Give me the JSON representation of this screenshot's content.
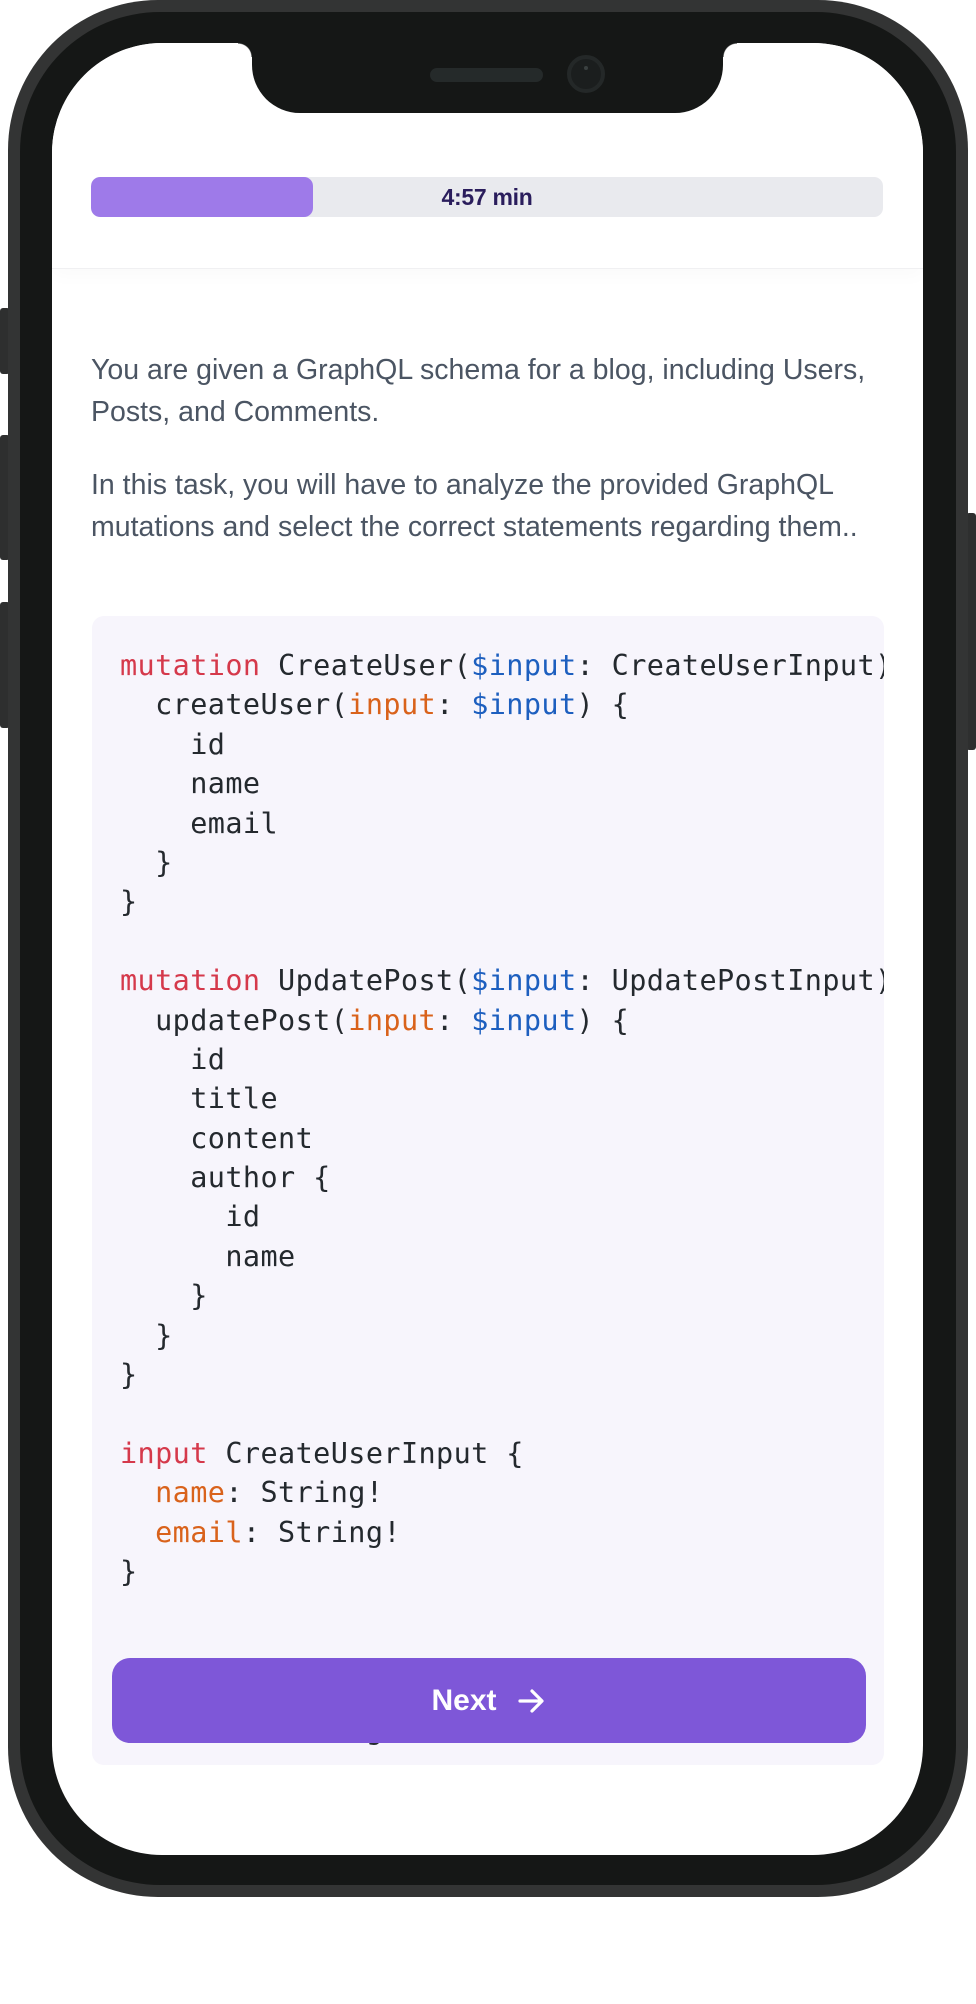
{
  "header": {
    "timer_label": "4:57 min",
    "progress_fraction": 0.28,
    "progress_fill_color": "#9e7ae9",
    "progress_track_color": "#e9eaee"
  },
  "intro": {
    "paragraphs": [
      "You are given a GraphQL schema for a blog, including Users, Posts, and Comments.",
      "In this task, you will have to analyze the provided GraphQL mutations and select the correct statements regarding them.."
    ]
  },
  "code": {
    "language": "graphql",
    "lines": [
      [
        {
          "t": "mutation",
          "k": "keyword"
        },
        {
          "t": " CreateUser(",
          "k": "plain"
        },
        {
          "t": "$input",
          "k": "variable"
        },
        {
          "t": ": CreateUserInput) {",
          "k": "plain"
        }
      ],
      [
        {
          "t": "  createUser(",
          "k": "plain"
        },
        {
          "t": "input",
          "k": "arg"
        },
        {
          "t": ": ",
          "k": "plain"
        },
        {
          "t": "$input",
          "k": "variable"
        },
        {
          "t": ") {",
          "k": "plain"
        }
      ],
      [
        {
          "t": "    id",
          "k": "plain"
        }
      ],
      [
        {
          "t": "    name",
          "k": "plain"
        }
      ],
      [
        {
          "t": "    email",
          "k": "plain"
        }
      ],
      [
        {
          "t": "  }",
          "k": "plain"
        }
      ],
      [
        {
          "t": "}",
          "k": "plain"
        }
      ],
      [],
      [
        {
          "t": "mutation",
          "k": "keyword"
        },
        {
          "t": " UpdatePost(",
          "k": "plain"
        },
        {
          "t": "$input",
          "k": "variable"
        },
        {
          "t": ": UpdatePostInput) {",
          "k": "plain"
        }
      ],
      [
        {
          "t": "  updatePost(",
          "k": "plain"
        },
        {
          "t": "input",
          "k": "arg"
        },
        {
          "t": ": ",
          "k": "plain"
        },
        {
          "t": "$input",
          "k": "variable"
        },
        {
          "t": ") {",
          "k": "plain"
        }
      ],
      [
        {
          "t": "    id",
          "k": "plain"
        }
      ],
      [
        {
          "t": "    title",
          "k": "plain"
        }
      ],
      [
        {
          "t": "    content",
          "k": "plain"
        }
      ],
      [
        {
          "t": "    author {",
          "k": "plain"
        }
      ],
      [
        {
          "t": "      id",
          "k": "plain"
        }
      ],
      [
        {
          "t": "      name",
          "k": "plain"
        }
      ],
      [
        {
          "t": "    }",
          "k": "plain"
        }
      ],
      [
        {
          "t": "  }",
          "k": "plain"
        }
      ],
      [
        {
          "t": "}",
          "k": "plain"
        }
      ],
      [],
      [
        {
          "t": "input",
          "k": "keyword"
        },
        {
          "t": " CreateUserInput {",
          "k": "plain"
        }
      ],
      [
        {
          "t": "  ",
          "k": "plain"
        },
        {
          "t": "name",
          "k": "arg"
        },
        {
          "t": ": String!",
          "k": "plain"
        }
      ],
      [
        {
          "t": "  ",
          "k": "plain"
        },
        {
          "t": "email",
          "k": "arg"
        },
        {
          "t": ": String!",
          "k": "plain"
        }
      ],
      [
        {
          "t": "}",
          "k": "plain"
        }
      ],
      [],
      [],
      [],
      [
        {
          "t": "  ",
          "k": "plain"
        },
        {
          "t": "title",
          "k": "arg"
        },
        {
          "t": ": String",
          "k": "plain"
        }
      ]
    ]
  },
  "actions": {
    "next_label": "Next",
    "next_icon": "arrow-right-icon",
    "next_color": "#7e57d8"
  }
}
